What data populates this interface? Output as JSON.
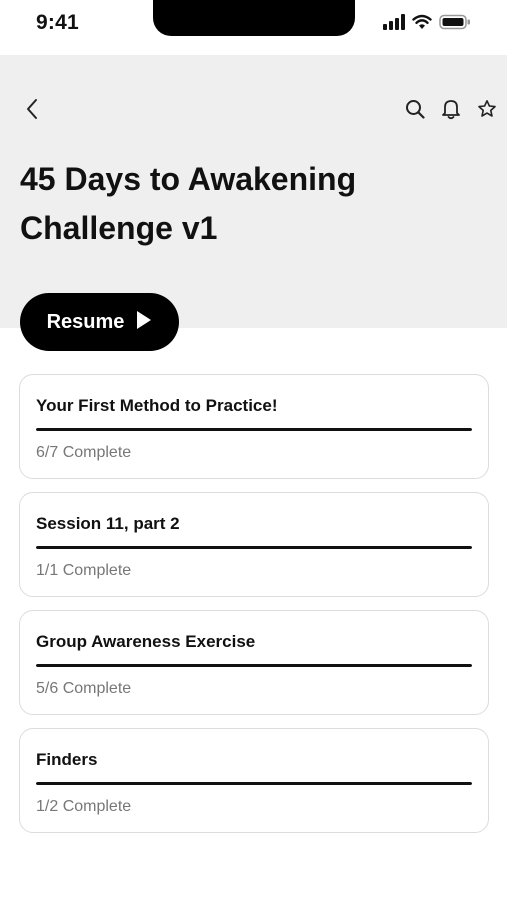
{
  "status_bar": {
    "time": "9:41",
    "icons": [
      "cellular-signal-icon",
      "wifi-icon",
      "battery-icon"
    ]
  },
  "header": {
    "back_icon": "chevron-left-icon",
    "actions": [
      "search-icon",
      "bell-icon",
      "star-icon"
    ],
    "title": "45 Days to Awakening Challenge v1",
    "background": "#efefef"
  },
  "resume_button": {
    "label": "Resume",
    "icon": "play-icon",
    "color": "#000000"
  },
  "sections": [
    {
      "title": "Your First Method to Practice!",
      "status": "6/7 Complete",
      "progress": 1.0
    },
    {
      "title": "Session 11, part 2",
      "status": "1/1 Complete",
      "progress": 1.0
    },
    {
      "title": "Group Awareness Exercise",
      "status": "5/6 Complete",
      "progress": 1.0
    },
    {
      "title": "Finders",
      "status": "1/2 Complete",
      "progress": 1.0
    }
  ]
}
